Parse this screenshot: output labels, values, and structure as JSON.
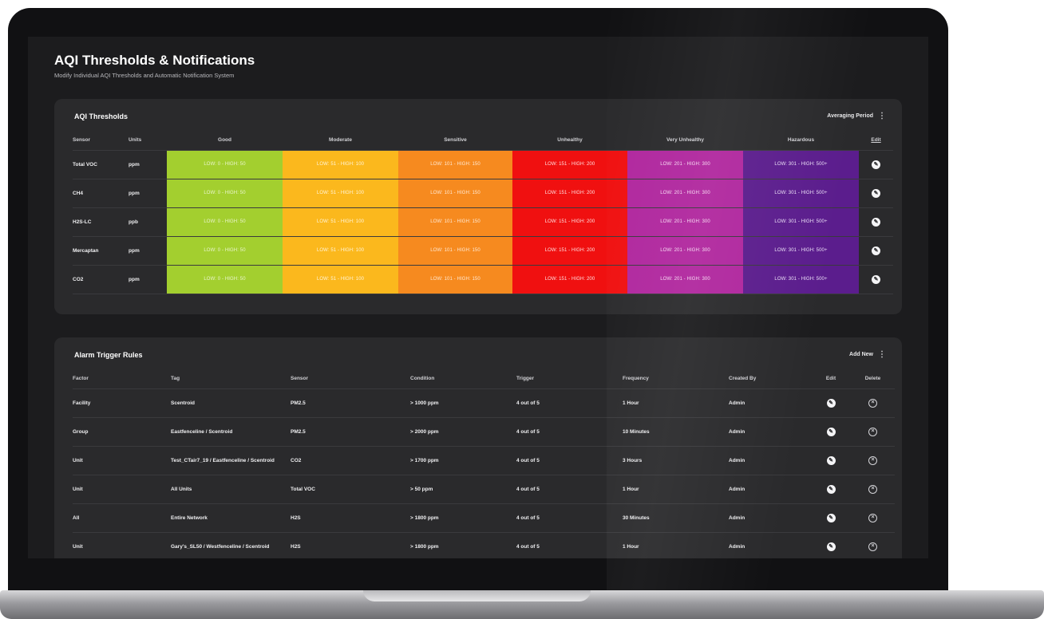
{
  "page": {
    "title": "AQI Thresholds & Notifications",
    "subtitle": "Modify Individual AQI Thresholds and Automatic Notification System"
  },
  "thresholds": {
    "title": "AQI Thresholds",
    "action_label": "Averaging Period",
    "action_icon": "kebab-menu-icon",
    "columns": [
      "Sensor",
      "Units",
      "Good",
      "Moderate",
      "Sensitive",
      "Unhealthy",
      "Very Unhealthy",
      "Hazardous",
      "Edit"
    ],
    "level_colors": {
      "good": "#a3cf2f",
      "moderate": "#fbb81d",
      "sensitive": "#f68a1f",
      "unhealthy": "#f01010",
      "very_unhealthy": "#b0279e",
      "hazardous": "#5b1d8d"
    },
    "rows": [
      {
        "sensor": "Total VOC",
        "units": "ppm",
        "good": "LOW: 0 - HIGH: 50",
        "moderate": "LOW: 51 - HIGH: 100",
        "sensitive": "LOW: 101 - HIGH: 150",
        "unhealthy": "LOW: 151 - HIGH: 200",
        "very": "LOW: 201 - HIGH: 300",
        "hazard": "LOW: 301 - HIGH: 500+"
      },
      {
        "sensor": "CH4",
        "units": "ppm",
        "good": "LOW: 0 - HIGH: 50",
        "moderate": "LOW: 51 - HIGH: 100",
        "sensitive": "LOW: 101 - HIGH: 150",
        "unhealthy": "LOW: 151 - HIGH: 200",
        "very": "LOW: 201 - HIGH: 300",
        "hazard": "LOW: 301 - HIGH: 500+"
      },
      {
        "sensor": "H2S-LC",
        "units": "ppb",
        "good": "LOW: 0 - HIGH: 50",
        "moderate": "LOW: 51 - HIGH: 100",
        "sensitive": "LOW: 101 - HIGH: 150",
        "unhealthy": "LOW: 151 - HIGH: 200",
        "very": "LOW: 201 - HIGH: 300",
        "hazard": "LOW: 301 - HIGH: 500+"
      },
      {
        "sensor": "Mercaptan",
        "units": "ppm",
        "good": "LOW: 0 - HIGH: 50",
        "moderate": "LOW: 51 - HIGH: 100",
        "sensitive": "LOW: 101 - HIGH: 150",
        "unhealthy": "LOW: 151 - HIGH: 200",
        "very": "LOW: 201 - HIGH: 300",
        "hazard": "LOW: 301 - HIGH: 500+"
      },
      {
        "sensor": "CO2",
        "units": "ppm",
        "good": "LOW: 0 - HIGH: 50",
        "moderate": "LOW: 51 - HIGH: 100",
        "sensitive": "LOW: 101 - HIGH: 150",
        "unhealthy": "LOW: 151 - HIGH: 200",
        "very": "LOW: 201 - HIGH: 300",
        "hazard": "LOW: 301 - HIGH: 500+"
      }
    ]
  },
  "alarms": {
    "title": "Alarm Trigger Rules",
    "action_label": "Add New",
    "action_icon": "kebab-menu-icon",
    "columns": [
      "Factor",
      "Tag",
      "Sensor",
      "Condition",
      "Trigger",
      "Frequency",
      "Created By",
      "Edit",
      "Delete"
    ],
    "rows": [
      {
        "factor": "Facility",
        "tag": "Scentroid",
        "sensor": "PM2.5",
        "condition": "> 1000 ppm",
        "trigger": "4 out of 5",
        "frequency": "1 Hour",
        "created_by": "Admin"
      },
      {
        "factor": "Group",
        "tag": "Eastfenceline / Scentroid",
        "sensor": "PM2.5",
        "condition": "> 2000 ppm",
        "trigger": "4 out of 5",
        "frequency": "10 Minutes",
        "created_by": "Admin"
      },
      {
        "factor": "Unit",
        "tag": "Test_CTair7_19 / Eastfenceline / Scentroid",
        "sensor": "CO2",
        "condition": "> 1700 ppm",
        "trigger": "4 out of 5",
        "frequency": "3 Hours",
        "created_by": "Admin"
      },
      {
        "factor": "Unit",
        "tag": "All Units",
        "sensor": "Total VOC",
        "condition": "> 50 ppm",
        "trigger": "4 out of 5",
        "frequency": "1 Hour",
        "created_by": "Admin"
      },
      {
        "factor": "All",
        "tag": "Entire Network",
        "sensor": "H2S",
        "condition": "> 1800 ppm",
        "trigger": "4 out of 5",
        "frequency": "30 Minutes",
        "created_by": "Admin"
      },
      {
        "factor": "Unit",
        "tag": "Gary's_SL50 / Westfenceline / Scentroid",
        "sensor": "H2S",
        "condition": "> 1800 ppm",
        "trigger": "4 out of 5",
        "frequency": "1 Hour",
        "created_by": "Admin"
      }
    ]
  },
  "icons": {
    "edit": "pencil-circle-icon",
    "delete": "close-circle-icon"
  }
}
